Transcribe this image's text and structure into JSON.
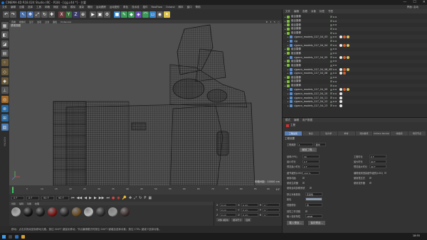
{
  "titlebar": {
    "title": "CINEMA 4D R18.024 Studio (RC - R18) - [cjg.c4d *] - 主要",
    "controls": [
      "—",
      "☐",
      "✕"
    ]
  },
  "menubar": {
    "items": [
      "文件",
      "编辑",
      "创建",
      "选择",
      "工具",
      "网格",
      "捕捉",
      "动画",
      "模拟",
      "渲染",
      "雕刻",
      "运动跟踪",
      "运动图形",
      "角色",
      "流水线",
      "插件",
      "RealFlow",
      "Octane",
      "脚本",
      "窗口",
      "帮助"
    ],
    "layout_label": "界面: 启动"
  },
  "viewport": {
    "menu": [
      "查看",
      "摄像机",
      "显示",
      "选项",
      "过滤",
      "面板",
      "ProRender"
    ],
    "camera_label": "透视视图",
    "grid_label": "网格间距 : 10000 cm"
  },
  "timeline": {
    "ticks": [
      "0",
      "5",
      "10",
      "15",
      "20",
      "25",
      "30",
      "35",
      "40",
      "45",
      "50",
      "55",
      "60",
      "65",
      "70",
      "75",
      "80",
      "85",
      "90"
    ],
    "current_frame": "0 F"
  },
  "transport": {
    "start": "0 F",
    "current": "0 F",
    "end": "90 F",
    "end2": "90 F"
  },
  "materials": {
    "menu": [
      "创建",
      "编辑",
      "功能",
      "纹理"
    ],
    "balls": [
      {
        "color": "#b0b0b0"
      },
      {
        "color": "#111111"
      },
      {
        "color": "#1a1a1a"
      },
      {
        "color": "#7a1010"
      },
      {
        "color": "#222222"
      },
      {
        "color": "#6a4a20"
      },
      {
        "color": "#c0c0c0"
      },
      {
        "color": "#2a2a2a"
      },
      {
        "color": "#9a9a9a"
      },
      {
        "color": "#3a2a2a"
      }
    ]
  },
  "coords": {
    "rows": [
      {
        "a": "X",
        "av": "0 cm",
        "b": "X",
        "bv": "0 cm",
        "c": "H",
        "cv": "0 °"
      },
      {
        "a": "Y",
        "av": "0 cm",
        "b": "Y",
        "bv": "0 cm",
        "c": "P",
        "cv": "0 °"
      },
      {
        "a": "Z",
        "av": "0 cm",
        "b": "Z",
        "bv": "0 cm",
        "c": "B",
        "cv": "0 °"
      }
    ],
    "mode": "对象 (相对)",
    "size_mode": "绝对尺寸",
    "apply": "应用"
  },
  "status": {
    "text": "移动：点击并拖动鼠标移动元素。按住 SHIFT 键量化移动；节点编辑模式时按住 SHIFT 键增加选择对象；按住 CTRL 键减少选择对象。"
  },
  "objmgr": {
    "menu": [
      "文件",
      "编辑",
      "查看",
      "对象",
      "标签",
      "书签"
    ],
    "rows": [
      {
        "name": "组合摄像",
        "indent": 0,
        "tags": 0
      },
      {
        "name": "组合摄像",
        "indent": 0,
        "tags": 0
      },
      {
        "name": "组合摄像",
        "indent": 0,
        "tags": 0
      },
      {
        "name": "组合摄像",
        "indent": 0,
        "tags": 0
      },
      {
        "name": "组合摄像",
        "indent": 0,
        "tags": 0
      },
      {
        "name": "cjgwcx_models_117_04_03",
        "indent": 1,
        "tags": 3
      },
      {
        "name": "cjg",
        "indent": 1,
        "tags": 0
      },
      {
        "name": "cjgwcx_models_117_04_04",
        "indent": 1,
        "tags": 3
      },
      {
        "name": "组合摄像",
        "indent": 0,
        "tags": 0
      },
      {
        "name": "组合摄像",
        "indent": 0,
        "tags": 0
      },
      {
        "name": "cjgwcx_models_117_04_05",
        "indent": 1,
        "tags": 3
      },
      {
        "name": "组合摄像",
        "indent": 0,
        "tags": 0
      },
      {
        "name": "组合摄像",
        "indent": 0,
        "tags": 0
      },
      {
        "name": "cjgwcx_models_117_04_06_0",
        "indent": 1,
        "tags": 3
      },
      {
        "name": "cjgwcx_models_117_04_08",
        "indent": 1,
        "tags": 2
      },
      {
        "name": "组合摄像",
        "indent": 0,
        "tags": 0
      },
      {
        "name": "组合摄像",
        "indent": 0,
        "tags": 0
      },
      {
        "name": "组合摄像",
        "indent": 0,
        "tags": 0
      },
      {
        "name": "cjgwcx_models_117_04_09",
        "indent": 1,
        "tags": 3
      },
      {
        "name": "cjgwcx_models_117_04_10",
        "indent": 1,
        "tags": 1
      },
      {
        "name": "cjgwcx_models_117_04_11",
        "indent": 1,
        "tags": 1
      },
      {
        "name": "cjgwcx_models_117_04_12",
        "indent": 1,
        "tags": 1
      },
      {
        "name": "cjgwcx_models_117_04_13",
        "indent": 1,
        "tags": 1
      }
    ]
  },
  "attrmgr": {
    "menu": [
      "模式",
      "编辑",
      "用户数据"
    ],
    "object_name": "工程",
    "tabs": [
      "工程设置",
      "信息",
      "动力学",
      "参考",
      "待办事项",
      "Octane Render",
      "帧插值",
      "场景节点"
    ],
    "section": "工程设置",
    "preset_label": "默认工程",
    "fields": {
      "scale_label": "工程缩放",
      "scale_val": "1",
      "scale_unit": "厘米",
      "scale_btn": "缩放工程...",
      "fps_label": "帧率(FPS)",
      "fps_val": "30",
      "time_label": "工程时长",
      "time_val": "0 F",
      "min_label": "最小时长",
      "min_val": "0 F",
      "max_label": "最大时长",
      "max_val": "90 F",
      "pmin_label": "预览最小时长",
      "pmin_val": "0 F",
      "pmax_label": "预览最大时长",
      "pmax_val": "90 F",
      "lod_label": "细节级别(LOD)",
      "lod_val": "100 %",
      "render_lod_label": "编辑使用渲染细节级别(LOD)",
      "anim_label": "使用动画",
      "expr_label": "使用表达式",
      "gen_label": "使用生成器",
      "deform_label": "使用变形器",
      "motion_label": "使用运动剪辑系统",
      "color_label": "默认对象颜色",
      "color_val": "灰蓝色",
      "view_color_label": "颜色",
      "clip_label": "视图修剪",
      "clip_val": "中",
      "linear_label": "线性工作流程",
      "input_label": "输入色彩特性",
      "input_val": "sRGB",
      "load_btn": "载入预设...",
      "save_btn": "保存预设..."
    }
  },
  "taskbar": {
    "clock": "18:55"
  }
}
